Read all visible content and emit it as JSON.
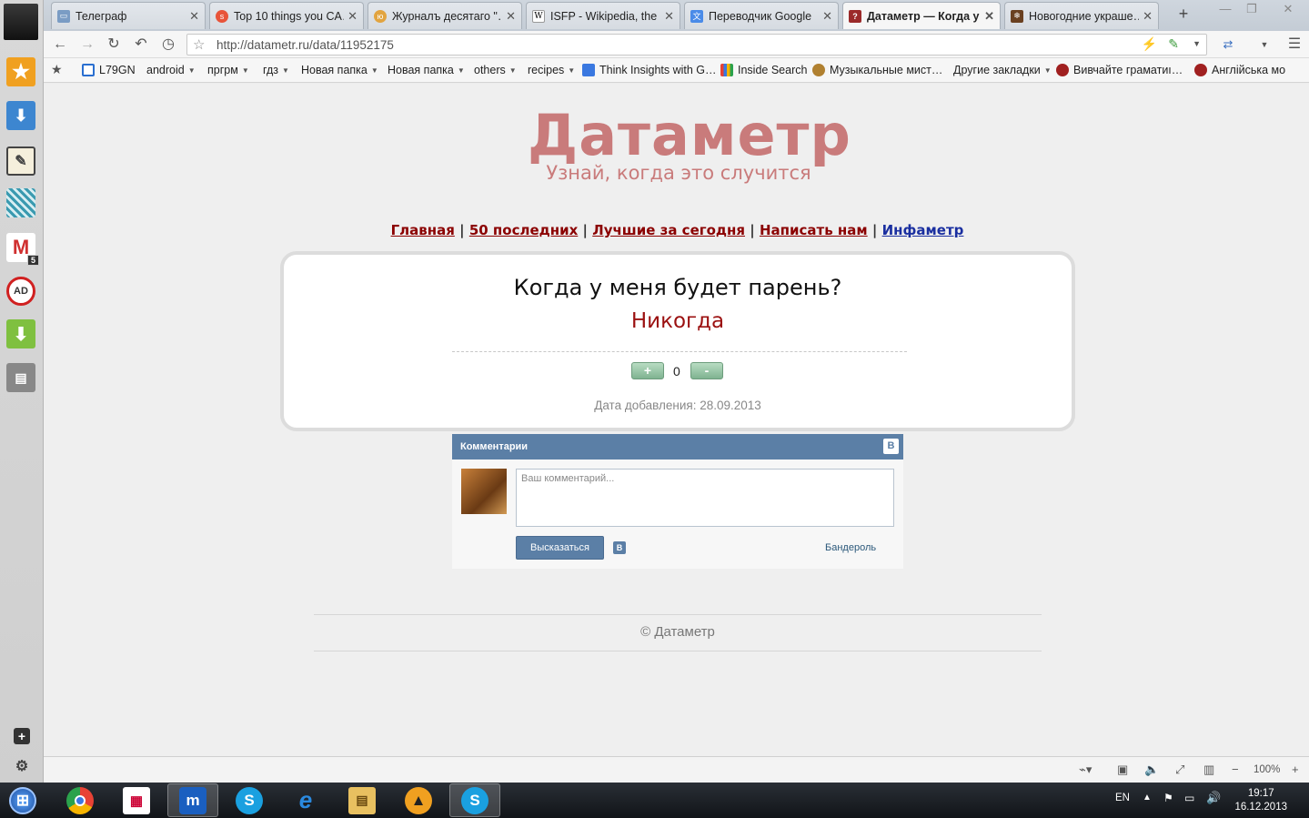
{
  "browser": {
    "tabs": [
      {
        "label": "Телеграф",
        "icon": "telegraph-favicon-icon",
        "active": false
      },
      {
        "label": "Top 10 things you CA…",
        "icon": "stumbleupon-favicon-icon",
        "active": false
      },
      {
        "label": "Журналъ десятаго \"…",
        "icon": "journal-favicon-icon",
        "active": false
      },
      {
        "label": "ISFP - Wikipedia, the …",
        "icon": "wikipedia-favicon-icon",
        "active": false
      },
      {
        "label": "Переводчик Google",
        "icon": "google-translate-favicon-icon",
        "active": false
      },
      {
        "label": "Датаметр — Когда у …",
        "icon": "datametr-favicon-icon",
        "active": true
      },
      {
        "label": "Новогодние украше…",
        "icon": "ornaments-favicon-icon",
        "active": false
      }
    ],
    "new_tab_label": "+",
    "url": "http://datametr.ru/data/11952175",
    "bookmarks": [
      {
        "label": "L79GN",
        "dropdown": false
      },
      {
        "label": "android",
        "dropdown": true
      },
      {
        "label": "пргрм",
        "dropdown": true
      },
      {
        "label": "гдз",
        "dropdown": true
      },
      {
        "label": "Новая папка",
        "dropdown": true
      },
      {
        "label": "Новая папка",
        "dropdown": true
      },
      {
        "label": "others",
        "dropdown": true
      },
      {
        "label": "recipes",
        "dropdown": true
      },
      {
        "label": "Think Insights with G…",
        "dropdown": false
      },
      {
        "label": "Inside Search",
        "dropdown": false
      },
      {
        "label": "Музыкальные мист…",
        "dropdown": false
      },
      {
        "label": "Другие закладки",
        "dropdown": true
      },
      {
        "label": "Вивчайте граматиı…",
        "dropdown": false
      },
      {
        "label": "Англійська мо",
        "dropdown": false
      }
    ],
    "zoom": "100%"
  },
  "site": {
    "logo": "Датаметр",
    "tagline": "Узнай, когда это случится",
    "nav": [
      "Главная",
      "50 последних",
      "Лучшие за сегодня",
      "Написать нам",
      "Инфаметр"
    ],
    "nav_separator": "|",
    "question": "Когда у меня будет парень?",
    "answer": "Никогда",
    "vote_plus": "+",
    "vote_minus": "-",
    "score": "0",
    "date_added": "Дата добавления: 28.09.2013",
    "comments": {
      "header": "Комментарии",
      "vk_letter": "В",
      "placeholder": "Ваш комментарий...",
      "submit": "Высказаться",
      "username": "Бандероль"
    },
    "copyright": "© Датаметр"
  },
  "taskbar": {
    "lang": "EN",
    "time": "19:17",
    "date": "16.12.2013"
  }
}
